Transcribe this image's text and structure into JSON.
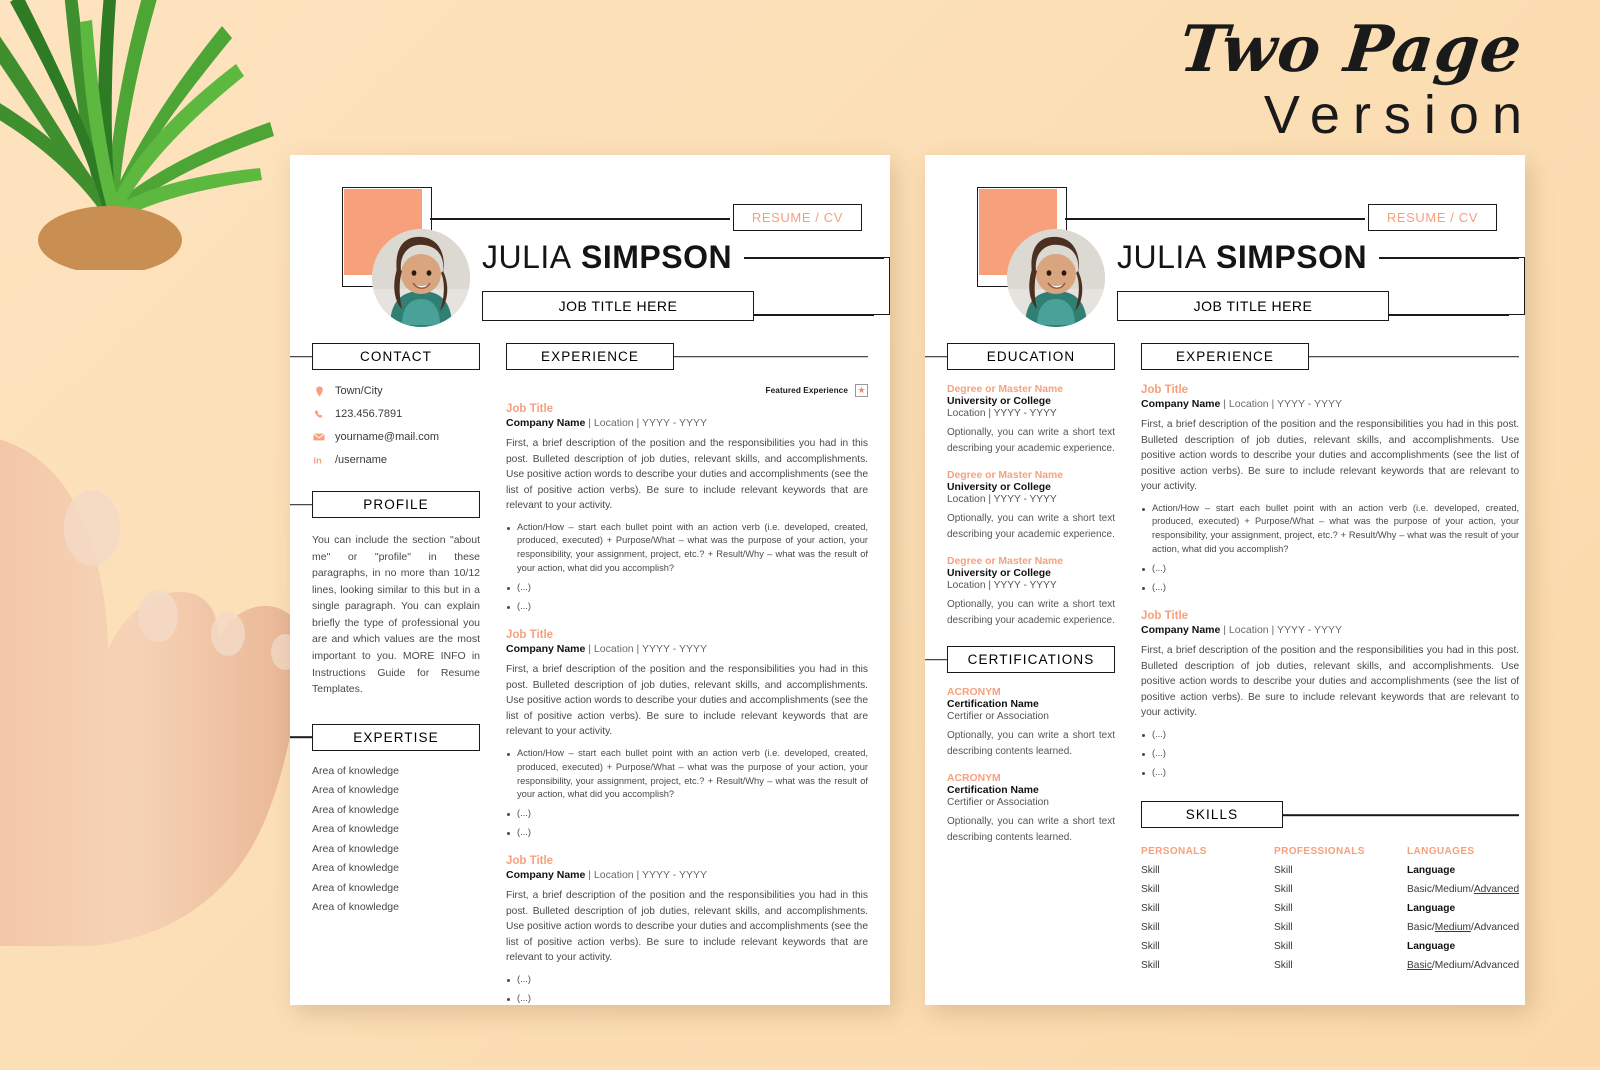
{
  "headline": {
    "line1": "Two Page",
    "line2": "Version"
  },
  "colors": {
    "background": "#fcdfb6",
    "accent": "#f7a07c",
    "ink": "#1a1a1a"
  },
  "header": {
    "resume_tag": "RESUME / CV",
    "first_name": "JULIA",
    "last_name": "SIMPSON",
    "job_title": "JOB TITLE HERE",
    "avatar_alt": "portrait-photo"
  },
  "sections": {
    "contact": "CONTACT",
    "profile": "PROFILE",
    "expertise": "EXPERTISE",
    "experience": "EXPERIENCE",
    "education": "EDUCATION",
    "certifications": "CERTIFICATIONS",
    "skills": "SKILLS"
  },
  "contact": {
    "items": [
      {
        "icon": "location-pin-icon",
        "glyph": "•",
        "text": "Town/City"
      },
      {
        "icon": "phone-icon",
        "glyph": "☎",
        "text": "123.456.7891"
      },
      {
        "icon": "envelope-icon",
        "glyph": "✉",
        "text": "yourname@mail.com"
      },
      {
        "icon": "linkedin-icon",
        "glyph": "in",
        "text": "/username"
      }
    ]
  },
  "profile": {
    "text": "You can include the section \"about me\" or \"profile\" in these paragraphs, in no more than 10/12 lines, looking similar to this but in a single paragraph. You can explain briefly the type of professional you are and which values are the most important to you. MORE INFO in Instructions Guide for Resume Templates."
  },
  "expertise": {
    "items": [
      "Area of knowledge",
      "Area of knowledge",
      "Area of knowledge",
      "Area of knowledge",
      "Area of knowledge",
      "Area of knowledge",
      "Area of knowledge",
      "Area of knowledge"
    ]
  },
  "featured_badge": {
    "label": "Featured Experience",
    "icon": "star-icon",
    "glyph": "★"
  },
  "experience_common": {
    "job_title": "Job Title",
    "company": "Company Name",
    "meta_rest": " | Location | YYYY - YYYY",
    "description": "First, a brief description of the position and the responsibilities you had in this post. Bulleted description of job duties, relevant skills, and accomplishments. Use positive action words to describe your duties and accomplishments (see the list of positive action verbs). Be sure to include relevant keywords that are relevant to your activity.",
    "bullet_long": "Action/How – start each bullet point with an action verb (i.e. developed, created, produced, executed) + Purpose/What – what was the purpose of your action, your responsibility, your assignment, project, etc.? + Result/Why – what was the result of your action, what did you accomplish?",
    "bullet_placeholder": "(...)"
  },
  "page1": {
    "jobs": [
      {
        "featured": true,
        "has_long_bullet": true,
        "placeholder_bullets": 2
      },
      {
        "featured": false,
        "has_long_bullet": true,
        "placeholder_bullets": 2
      },
      {
        "featured": false,
        "has_long_bullet": false,
        "placeholder_bullets": 3
      }
    ]
  },
  "page2": {
    "jobs": [
      {
        "featured": false,
        "has_long_bullet": true,
        "placeholder_bullets": 2
      },
      {
        "featured": false,
        "has_long_bullet": false,
        "placeholder_bullets": 3
      }
    ],
    "education": {
      "items": [
        {
          "degree": "Degree or Master Name",
          "school": "University or College",
          "location": "Location | YYYY - YYYY",
          "note": "Optionally, you can write a short text describing your academic experience."
        },
        {
          "degree": "Degree or Master Name",
          "school": "University or College",
          "location": "Location | YYYY - YYYY",
          "note": "Optionally, you can write a short text describing your academic experience."
        },
        {
          "degree": "Degree or Master Name",
          "school": "University or College",
          "location": "Location | YYYY - YYYY",
          "note": "Optionally, you can write a short text describing your academic experience."
        }
      ]
    },
    "certifications": {
      "items": [
        {
          "acronym": "ACRONYM",
          "name": "Certification Name",
          "issuer": "Certifier or Association",
          "note": "Optionally, you can write a short text describing contents learned."
        },
        {
          "acronym": "ACRONYM",
          "name": "Certification Name",
          "issuer": "Certifier or Association",
          "note": "Optionally, you can write a short text describing contents learned."
        }
      ]
    },
    "skills": {
      "columns": [
        {
          "heading": "PERSONALS",
          "items": [
            {
              "text": "Skill",
              "bold": false
            },
            {
              "text": "Skill",
              "bold": false
            },
            {
              "text": "Skill",
              "bold": false
            },
            {
              "text": "Skill",
              "bold": false
            },
            {
              "text": "Skill",
              "bold": false
            },
            {
              "text": "Skill",
              "bold": false
            }
          ]
        },
        {
          "heading": "PROFESSIONALS",
          "items": [
            {
              "text": "Skill",
              "bold": false
            },
            {
              "text": "Skill",
              "bold": false
            },
            {
              "text": "Skill",
              "bold": false
            },
            {
              "text": "Skill",
              "bold": false
            },
            {
              "text": "Skill",
              "bold": false
            },
            {
              "text": "Skill",
              "bold": false
            }
          ]
        },
        {
          "heading": "LANGUAGES",
          "items": [
            {
              "text": "Language",
              "bold": true
            },
            {
              "html": "Basic/Medium/<u>Advanced</u>",
              "bold": false
            },
            {
              "text": "Language",
              "bold": true
            },
            {
              "html": "Basic/<u>Medium</u>/Advanced",
              "bold": false
            },
            {
              "text": "Language",
              "bold": true
            },
            {
              "html": "<u>Basic</u>/Medium/Advanced",
              "bold": false
            }
          ]
        }
      ]
    }
  }
}
